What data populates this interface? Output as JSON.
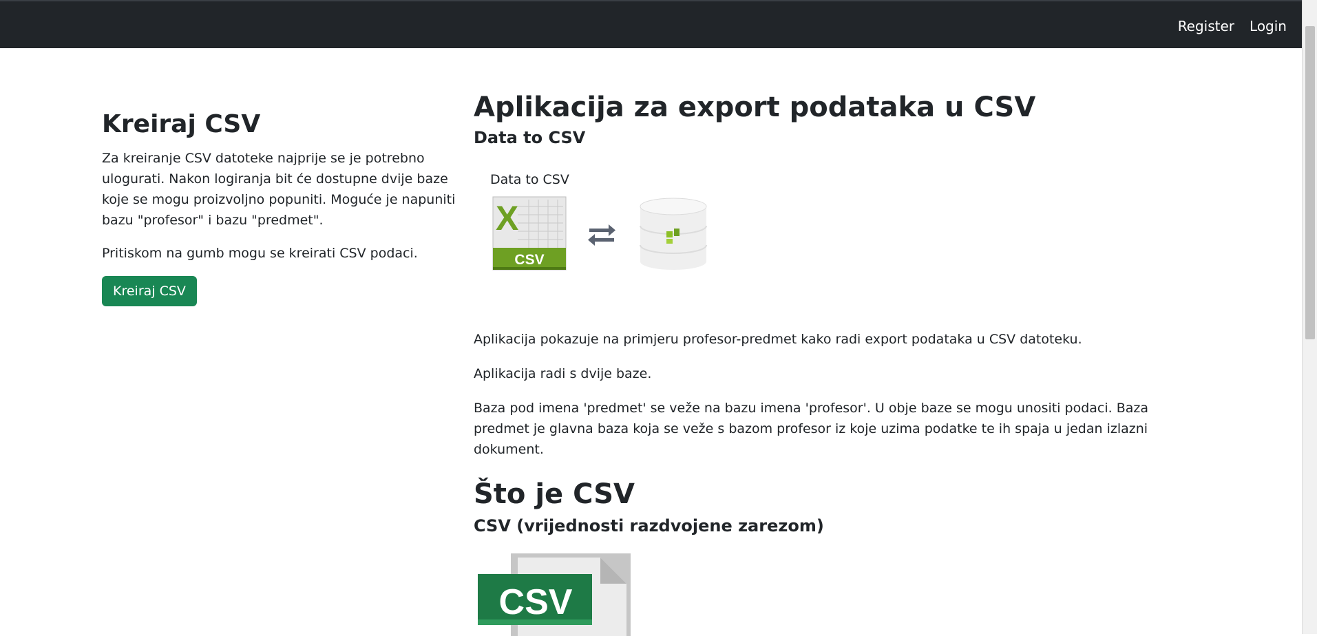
{
  "navbar": {
    "links": [
      {
        "label": "Register"
      },
      {
        "label": "Login"
      }
    ]
  },
  "sidebar": {
    "title": "Kreiraj CSV",
    "description": "Za kreiranje CSV datoteke najprije se je potrebno ulogurati. Nakon logiranja bit će dostupne dvije baze koje se mogu proizvoljno popuniti. Moguće je napuniti bazu \"profesor\" i bazu \"predmet\".",
    "note": "Pritiskom na gumb mogu se kreirati CSV podaci.",
    "button_label": "Kreiraj CSV"
  },
  "main": {
    "title": "Aplikacija za export podataka u CSV",
    "subtitle": "Data to CSV",
    "figure": {
      "caption": "Data to CSV",
      "csv_badge": "CSV",
      "excel_letter": "X",
      "icons": [
        "excel-csv-icon",
        "exchange-arrows-icon",
        "database-icon"
      ]
    },
    "paragraphs": [
      "Aplikacija pokazuje na primjeru profesor-predmet kako radi export podataka u CSV datoteku.",
      "Aplikacija radi s dvije baze.",
      "Baza pod imena 'predmet' se veže na bazu imena 'profesor'. U obje baze se mogu unositi podaci. Baza predmet je glavna baza koja se veže s bazom profesor iz koje uzima podatke te ih spaja u jedan izlazni dokument."
    ],
    "section2": {
      "title": "Što je CSV",
      "subtitle": "CSV (vrijednosti razdvojene zarezom)",
      "image_label": "CSV"
    }
  },
  "colors": {
    "navbar_bg": "#212529",
    "button_bg": "#198754",
    "csv_green": "#1e7a46",
    "excel_green": "#6ea023"
  }
}
